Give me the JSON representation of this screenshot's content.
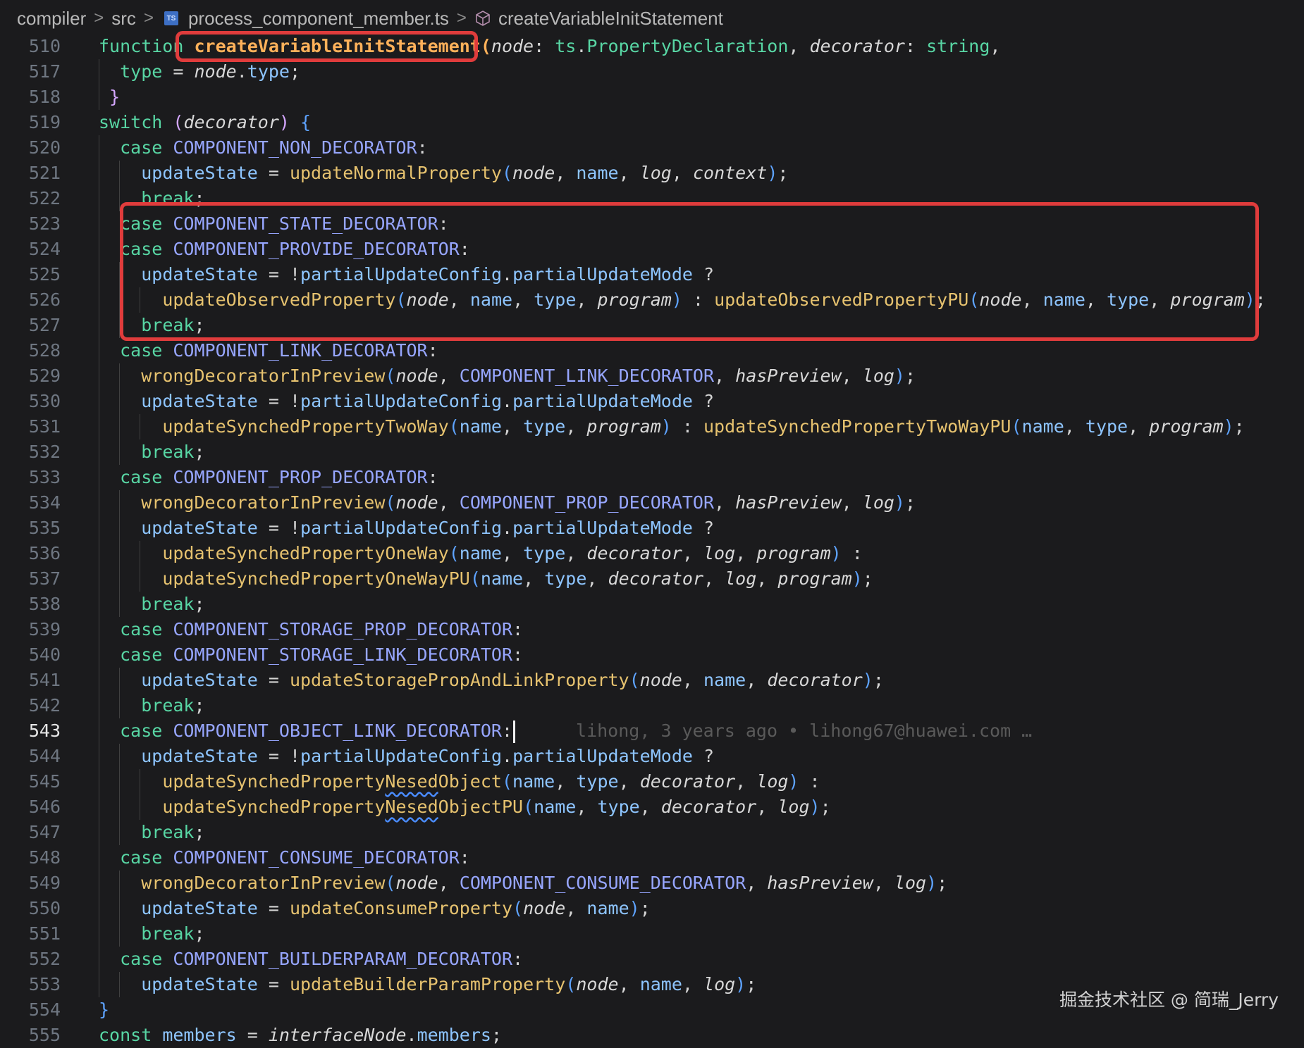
{
  "breadcrumb": {
    "items": [
      "compiler",
      "src",
      "process_component_member.ts",
      "createVariableInitStatement"
    ],
    "ts_badge": "TS"
  },
  "editor": {
    "active_line": 543,
    "blame": "lihong, 3 years ago • lihong67@huawei.com …",
    "lines": [
      {
        "num": 510
      },
      {
        "num": 517
      },
      {
        "num": 518
      },
      {
        "num": 519
      },
      {
        "num": 520
      },
      {
        "num": 521
      },
      {
        "num": 522
      },
      {
        "num": 523
      },
      {
        "num": 524
      },
      {
        "num": 525
      },
      {
        "num": 526
      },
      {
        "num": 527
      },
      {
        "num": 528
      },
      {
        "num": 529
      },
      {
        "num": 530
      },
      {
        "num": 531
      },
      {
        "num": 532
      },
      {
        "num": 533
      },
      {
        "num": 534
      },
      {
        "num": 535
      },
      {
        "num": 536
      },
      {
        "num": 537
      },
      {
        "num": 538
      },
      {
        "num": 539
      },
      {
        "num": 540
      },
      {
        "num": 541
      },
      {
        "num": 542
      },
      {
        "num": 543
      },
      {
        "num": 544
      },
      {
        "num": 545
      },
      {
        "num": 546
      },
      {
        "num": 547
      },
      {
        "num": 548
      },
      {
        "num": 549
      },
      {
        "num": 550
      },
      {
        "num": 551
      },
      {
        "num": 552
      },
      {
        "num": 553
      },
      {
        "num": 554
      },
      {
        "num": 555
      }
    ]
  },
  "watermark": "掘金技术社区 @ 简瑞_Jerry",
  "colors": {
    "highlight_box": "#e03c3c",
    "background": "#1b1b1d",
    "keyword": "#58d6a4",
    "function": "#e6c26f",
    "constant": "#97a6ff",
    "variable": "#8ec5ff"
  },
  "icons": {
    "file_icon": "typescript-file-icon",
    "symbol_icon": "method-cube-icon",
    "separator": "chevron-right-icon"
  }
}
